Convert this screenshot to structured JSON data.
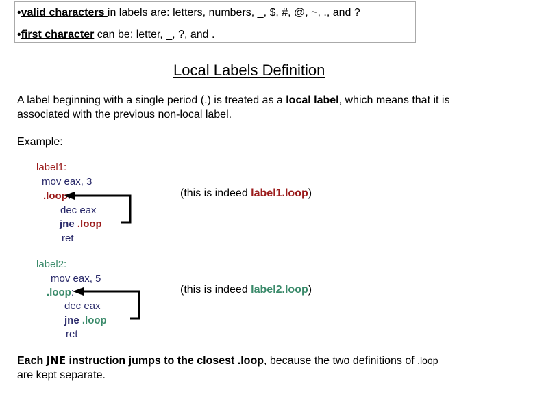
{
  "rules": {
    "valid_bold": "valid characters ",
    "valid_rest": "in labels are:  letters, numbers, _, $, #, @, ~, ., and ?",
    "first_bold": "first character",
    "first_rest": " can be: letter,  _,  ?, and ."
  },
  "title": "Local Labels Definition",
  "desc": {
    "pre": "A label beginning with a single period (.) is treated as a ",
    "bold": "local label",
    "post": ", which means that it is",
    "line2": "associated with the previous non-local label."
  },
  "example_label": "Example:",
  "block1": {
    "label": "label1:",
    "mov": "mov eax, 3",
    "loop": ".loop",
    "colon": ":",
    "dec": "dec eax",
    "jne": "jne",
    "jne_target": " .loop",
    "ret": "ret",
    "note_pre": "(this is indeed ",
    "note_hl": "label1.loop",
    "note_post": ")"
  },
  "block2": {
    "label": "label2:",
    "mov": "mov eax, 5",
    "loop": ".loop",
    "colon": ":",
    "dec": "dec eax",
    "jne": "jne",
    "jne_target": " .loop",
    "ret": "ret",
    "note_pre": "(this is indeed ",
    "note_hl": "label2.loop",
    "note_post": ")"
  },
  "footer": {
    "b1": "Each ",
    "jne": "JNE",
    "b2": " instruction jumps to the closest .loop",
    "rest": ", because the two definitions of ",
    "loop": ".loop",
    "line2": "are kept separate."
  },
  "colors": {
    "label1": "#9b1b1b",
    "label2": "#3a8a6a",
    "code": "#2a2a6a"
  }
}
